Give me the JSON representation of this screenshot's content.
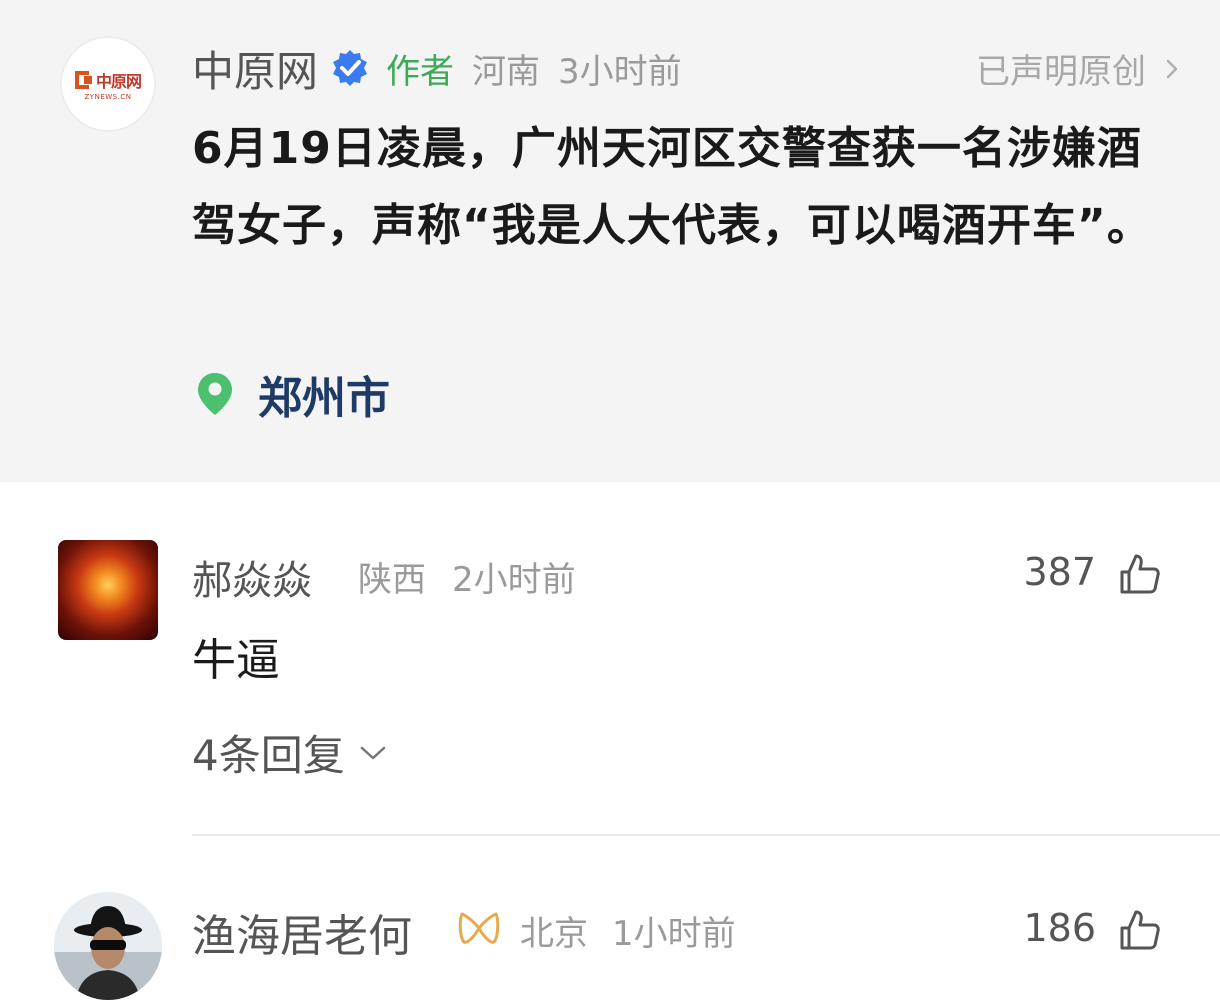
{
  "post": {
    "avatar": {
      "logo_text": "中原网",
      "logo_sub": "ZYNEWS.CN"
    },
    "author": "中原网",
    "author_tag": "作者",
    "region": "河南",
    "time": "3小时前",
    "original_label": "已声明原创",
    "text": "6月19日凌晨，广州天河区交警查获一名涉嫌酒驾女子，声称“我是人大代表，可以喝酒开车”。",
    "location": "郑州市",
    "icons": {
      "verified": "verified-badge-icon",
      "chevron": "chevron-right-icon",
      "location": "location-pin-icon"
    }
  },
  "comments": [
    {
      "user": "郝焱焱",
      "region": "陕西",
      "time": "2小时前",
      "likes": "387",
      "text": "牛逼",
      "replies": "4条回复"
    },
    {
      "user": "渔海居老何",
      "region": "北京",
      "time": "1小时前",
      "likes": "186"
    }
  ],
  "colors": {
    "accent_green": "#3daa5a",
    "location_blue": "#1d3b66",
    "verified_blue": "#3a7bf0",
    "vip_gold": "#e8a84c"
  }
}
